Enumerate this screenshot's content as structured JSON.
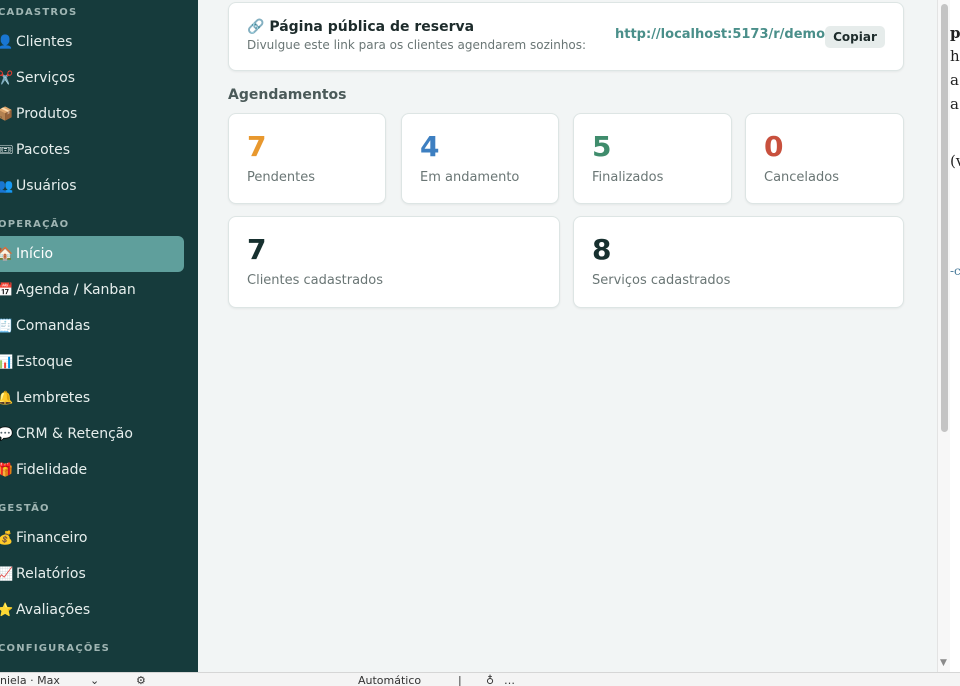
{
  "sidebar": {
    "sections": {
      "cadastros": "CADASTROS",
      "operacao": "OPERAÇÃO",
      "gestao": "GESTÃO",
      "configuracoes": "CONFIGURAÇÕES"
    },
    "items": {
      "clientes": {
        "icon": "👤",
        "label": "Clientes"
      },
      "servicos": {
        "icon": "✂️",
        "label": "Serviços"
      },
      "produtos": {
        "icon": "📦",
        "label": "Produtos"
      },
      "pacotes": {
        "icon": "🎟",
        "label": "Pacotes"
      },
      "usuarios": {
        "icon": "👥",
        "label": "Usuários"
      },
      "inicio": {
        "icon": "🏠",
        "label": "Início"
      },
      "agenda": {
        "icon": "📅",
        "label": "Agenda / Kanban"
      },
      "comandas": {
        "icon": "🧾",
        "label": "Comandas"
      },
      "estoque": {
        "icon": "📊",
        "label": "Estoque"
      },
      "lembretes": {
        "icon": "🔔",
        "label": "Lembretes"
      },
      "crm": {
        "icon": "💬",
        "label": "CRM & Retenção"
      },
      "fidelidade": {
        "icon": "🎁",
        "label": "Fidelidade"
      },
      "financeiro": {
        "icon": "💰",
        "label": "Financeiro"
      },
      "relatorios": {
        "icon": "📈",
        "label": "Relatórios"
      },
      "avaliacoes": {
        "icon": "⭐",
        "label": "Avaliações"
      }
    },
    "active": "inicio"
  },
  "public_link": {
    "icon": "🔗",
    "title": "Página pública de reserva",
    "subtitle": "Divulgue este link para os clientes agendarem sozinhos:",
    "url": "http://localhost:5173/r/demo",
    "copy_label": "Copiar"
  },
  "agendamentos": {
    "heading": "Agendamentos",
    "stats": [
      {
        "value": "7",
        "label": "Pendentes",
        "color": "#e8982e"
      },
      {
        "value": "4",
        "label": "Em andamento",
        "color": "#3d7fc1"
      },
      {
        "value": "5",
        "label": "Finalizados",
        "color": "#3f8c6c"
      },
      {
        "value": "0",
        "label": "Cancelados",
        "color": "#c8503d"
      }
    ],
    "totals": [
      {
        "value": "7",
        "label": "Clientes cadastrados",
        "color": "#17302f"
      },
      {
        "value": "8",
        "label": "Serviços cadastrados",
        "color": "#17302f"
      }
    ]
  },
  "statusbar": {
    "left": "niela · Max",
    "middle": "Automático"
  },
  "right_peek": [
    "pc",
    "ha",
    "a",
    "a",
    "(v",
    "-c"
  ]
}
